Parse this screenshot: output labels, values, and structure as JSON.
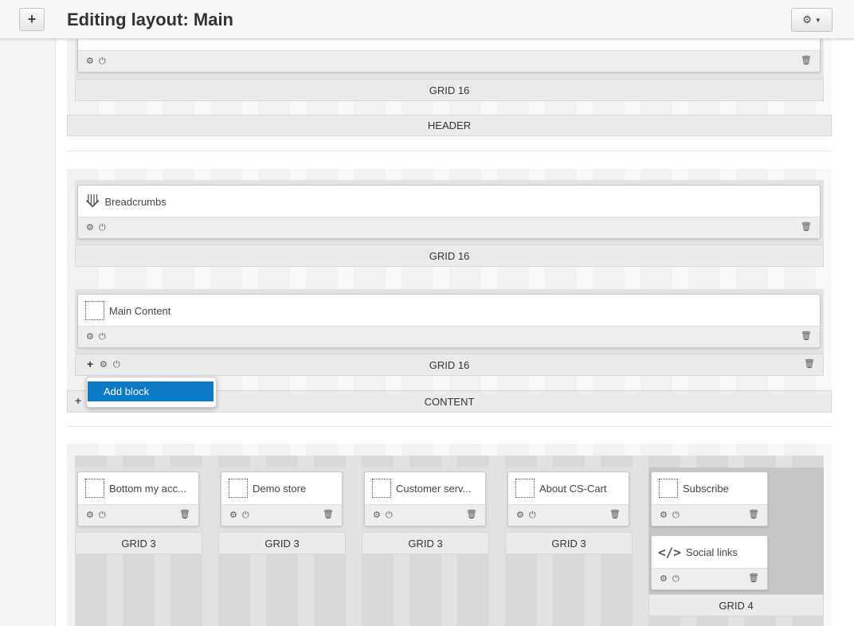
{
  "header": {
    "title": "Editing layout: Main",
    "add_icon": "plus-icon",
    "settings_icon": "gear-icon"
  },
  "top_section": {
    "grid_label": "GRID 16",
    "container_label": "HEADER"
  },
  "content_section": {
    "container_label": "CONTENT",
    "grids": [
      {
        "label": "GRID 16",
        "blocks": [
          {
            "title": "Breadcrumbs",
            "icon": "signpost-icon"
          }
        ]
      },
      {
        "label": "GRID 16",
        "blocks": [
          {
            "title": "Main Content",
            "icon": "dotted-box-icon"
          }
        ]
      }
    ],
    "menu": {
      "add_block": "Add block"
    }
  },
  "footer_section": {
    "grids": [
      {
        "label": "GRID 3",
        "blocks": [
          {
            "title": "Bottom my acc...",
            "icon": "dotted-box-icon"
          }
        ]
      },
      {
        "label": "GRID 3",
        "blocks": [
          {
            "title": "Demo store",
            "icon": "dotted-box-icon"
          }
        ]
      },
      {
        "label": "GRID 3",
        "blocks": [
          {
            "title": "Customer serv...",
            "icon": "dotted-box-icon"
          }
        ]
      },
      {
        "label": "GRID 3",
        "blocks": [
          {
            "title": "About CS-Cart",
            "icon": "dotted-box-icon"
          }
        ]
      },
      {
        "label": "GRID 4",
        "blocks": [
          {
            "title": "Subscribe",
            "icon": "dotted-box-icon"
          },
          {
            "title": "Social links",
            "icon": "code-icon"
          }
        ]
      }
    ]
  }
}
